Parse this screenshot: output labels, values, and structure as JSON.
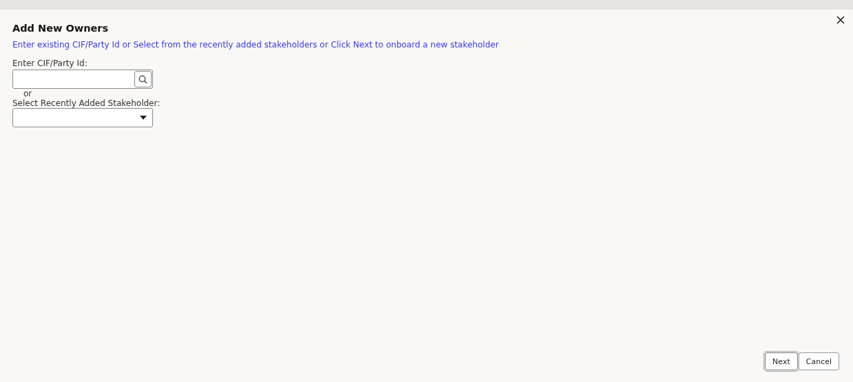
{
  "dialog": {
    "title": "Add New Owners",
    "instruction": "Enter existing CIF/Party Id or Select from the recently added stakeholders or Click Next to onboard a new stakeholder"
  },
  "cif_field": {
    "label": "Enter CIF/Party Id:"
  },
  "separator": "or",
  "stakeholder_select": {
    "label": "Select Recently Added Stakeholder:"
  },
  "buttons": [
    {
      "label": "Next",
      "focused": true
    },
    {
      "label": "Cancel",
      "focused": false
    }
  ]
}
